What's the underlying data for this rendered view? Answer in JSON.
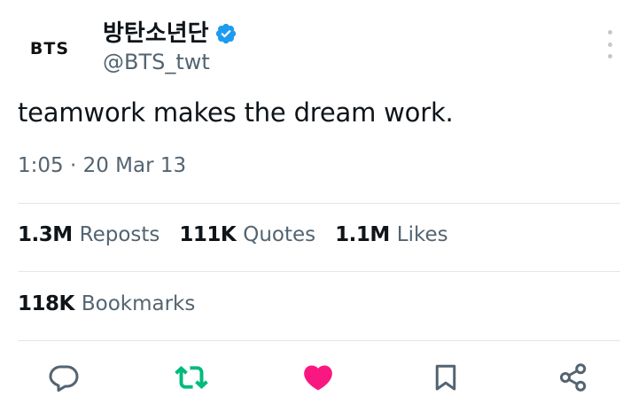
{
  "author": {
    "avatar_text": "BTS",
    "display_name": "방탄소년단",
    "handle": "@BTS_twt",
    "verified_color": "#1d9bf0"
  },
  "tweet": {
    "text": "teamwork makes the dream work.",
    "timestamp": "1:05 · 20 Mar 13"
  },
  "stats": {
    "reposts": {
      "count": "1.3M",
      "label": "Reposts"
    },
    "quotes": {
      "count": "111K",
      "label": "Quotes"
    },
    "likes": {
      "count": "1.1M",
      "label": "Likes"
    },
    "bookmarks": {
      "count": "118K",
      "label": "Bookmarks"
    }
  },
  "actions": {
    "reply": {
      "icon": "reply-icon",
      "color": "#536471"
    },
    "repost": {
      "icon": "repost-icon",
      "color": "#00ba7c",
      "active": true
    },
    "like": {
      "icon": "heart-icon",
      "color": "#f91880",
      "active": true
    },
    "bookmark": {
      "icon": "bookmark-icon",
      "color": "#536471"
    },
    "share": {
      "icon": "share-icon",
      "color": "#536471"
    }
  },
  "more_menu": {
    "icon": "more-vertical-icon"
  }
}
